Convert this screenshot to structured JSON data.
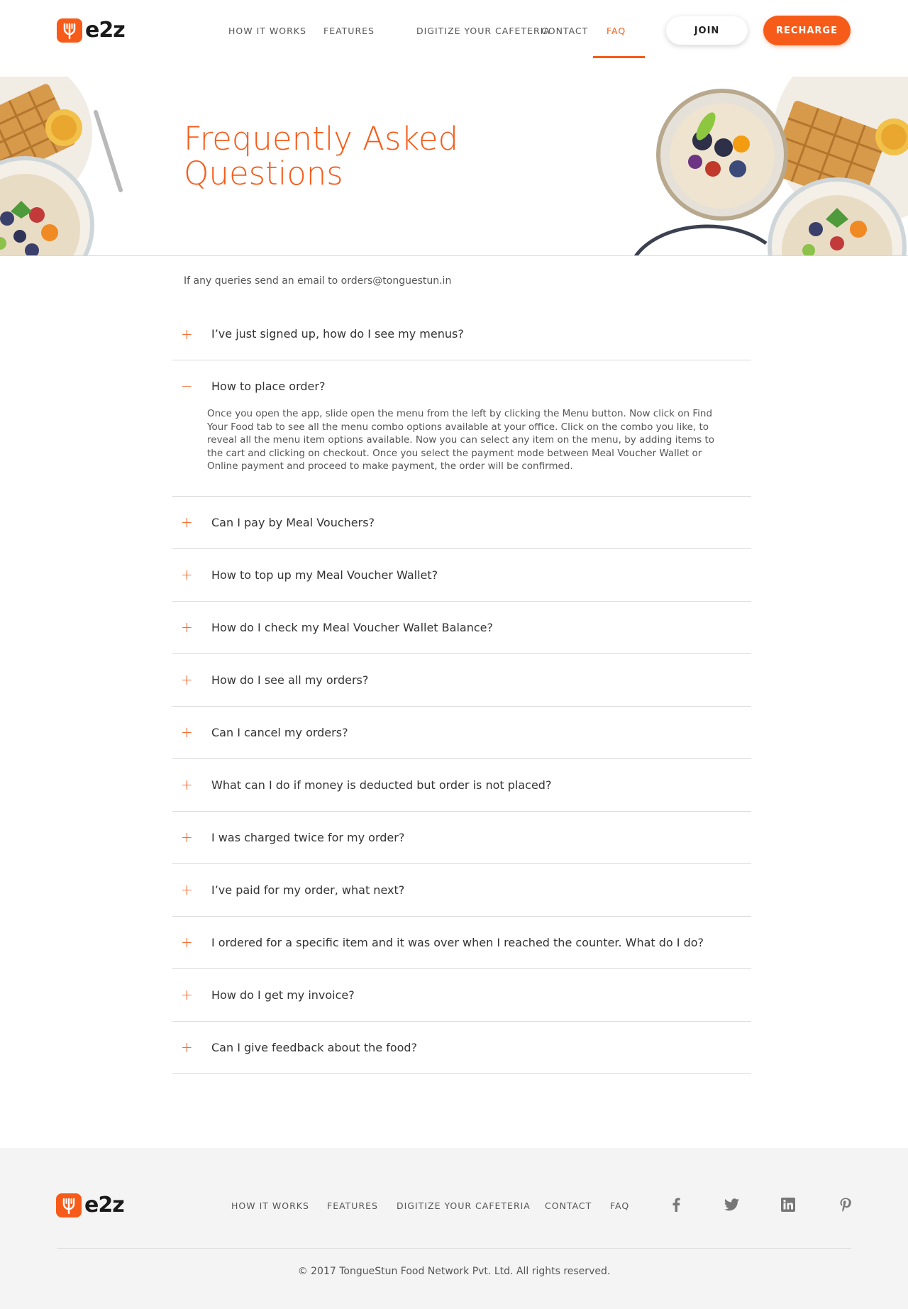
{
  "header": {
    "logo_text": "e2z",
    "nav": [
      {
        "label": "HOW IT WORKS"
      },
      {
        "label": "FEATURES"
      },
      {
        "label": "DIGITIZE YOUR CAFETERIA"
      },
      {
        "label": "CONTACT"
      },
      {
        "label": "FAQ",
        "active": true
      }
    ],
    "join_label": "JOIN",
    "recharge_label": "RECHARGE"
  },
  "hero": {
    "title_line1": "Frequently Asked",
    "title_line2": "Questions"
  },
  "intro": "If any queries send an email to orders@tonguestun.in",
  "faq": [
    {
      "question": "I’ve just signed up, how do I see my menus?",
      "icon": "+"
    },
    {
      "question": "How to place order?",
      "icon": "−",
      "open": true,
      "answer": "Once you open the app, slide open the menu from the left by clicking the Menu button. Now click on Find Your Food tab to see all the menu combo options available at your office. Click on the combo you like, to reveal all the menu item options available. Now you can select any item on the menu, by adding items to the cart and clicking on checkout. Once you select the payment mode between Meal Voucher Wallet or Online payment and proceed to make payment, the order will be confirmed."
    },
    {
      "question": "Can I pay by Meal Vouchers?",
      "icon": "+"
    },
    {
      "question": "How to top up my Meal Voucher Wallet?",
      "icon": "+"
    },
    {
      "question": "How do I check my Meal Voucher Wallet Balance?",
      "icon": "+"
    },
    {
      "question": "How do I see all my orders?",
      "icon": "+"
    },
    {
      "question": "Can I cancel my orders?",
      "icon": "+"
    },
    {
      "question": "What can I do if money is deducted but order is not placed?",
      "icon": "+"
    },
    {
      "question": "I was charged twice for my order?",
      "icon": "+"
    },
    {
      "question": "I’ve paid for my order, what next?",
      "icon": "+"
    },
    {
      "question": "I ordered for a specific item and it was over when I reached the counter. What do I do?",
      "icon": "+"
    },
    {
      "question": "How do I get my invoice?",
      "icon": "+"
    },
    {
      "question": "Can I give feedback about the food?",
      "icon": "+"
    }
  ],
  "footer": {
    "logo_text": "e2z",
    "nav": [
      "HOW IT WORKS",
      "FEATURES",
      "DIGITIZE YOUR CAFETERIA",
      "CONTACT",
      "FAQ"
    ],
    "social": [
      "facebook-icon",
      "twitter-icon",
      "linkedin-icon",
      "pinterest-icon"
    ],
    "copyright": "© 2017 TongueStun Food Network Pvt. Ltd. All rights reserved."
  },
  "colors": {
    "accent": "#f75b19",
    "text": "#333333",
    "footer_bg": "#f4f4f4"
  }
}
